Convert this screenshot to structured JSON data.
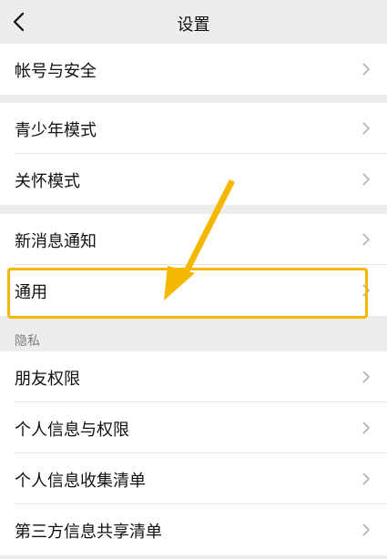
{
  "header": {
    "title": "设置",
    "back_icon": "chevron-left-icon"
  },
  "groups": [
    {
      "items": [
        {
          "label": "帐号与安全"
        }
      ]
    },
    {
      "items": [
        {
          "label": "青少年模式"
        },
        {
          "label": "关怀模式"
        }
      ]
    },
    {
      "items": [
        {
          "label": "新消息通知"
        },
        {
          "label": "通用"
        }
      ]
    }
  ],
  "privacy": {
    "section_label": "隐私",
    "items": [
      {
        "label": "朋友权限"
      },
      {
        "label": "个人信息与权限"
      },
      {
        "label": "个人信息收集清单"
      },
      {
        "label": "第三方信息共享清单"
      }
    ]
  },
  "annotation": {
    "highlight_color": "#f5b800",
    "highlighted_item": "通用"
  }
}
